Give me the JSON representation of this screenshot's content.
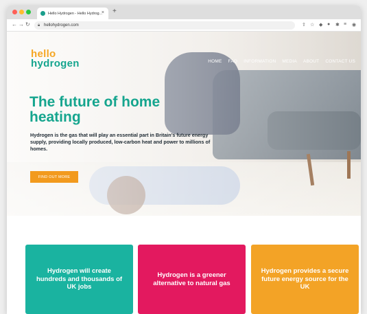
{
  "browser": {
    "tab_title": "Hello Hydrogen - Hello Hydrog...",
    "tab_close": "×",
    "new_tab": "+",
    "url": "hellohydrogen.com"
  },
  "site": {
    "logo_line1": "hello",
    "logo_line2": "hydrogen",
    "nav": [
      "HOME",
      "FAQ",
      "INFORMATION",
      "MEDIA",
      "ABOUT",
      "CONTACT US"
    ],
    "hero": {
      "headline": "The future of home heating",
      "subtext": "Hydrogen is the gas that will play an essential part in Britain's future energy supply, providing locally produced, low-carbon heat and power to millions of homes.",
      "cta": "FIND OUT MORE"
    },
    "cards": [
      "Hydrogen will create hundreds and thousands of UK jobs",
      "Hydrogen is a greener alternative to natural gas",
      "Hydrogen provides a secure future energy source for the UK"
    ]
  },
  "colors": {
    "brand_teal": "#15a58e",
    "brand_orange": "#f5a623",
    "card_teal": "#1ab3a0",
    "card_pink": "#e3195f",
    "card_orange": "#f3a326"
  }
}
